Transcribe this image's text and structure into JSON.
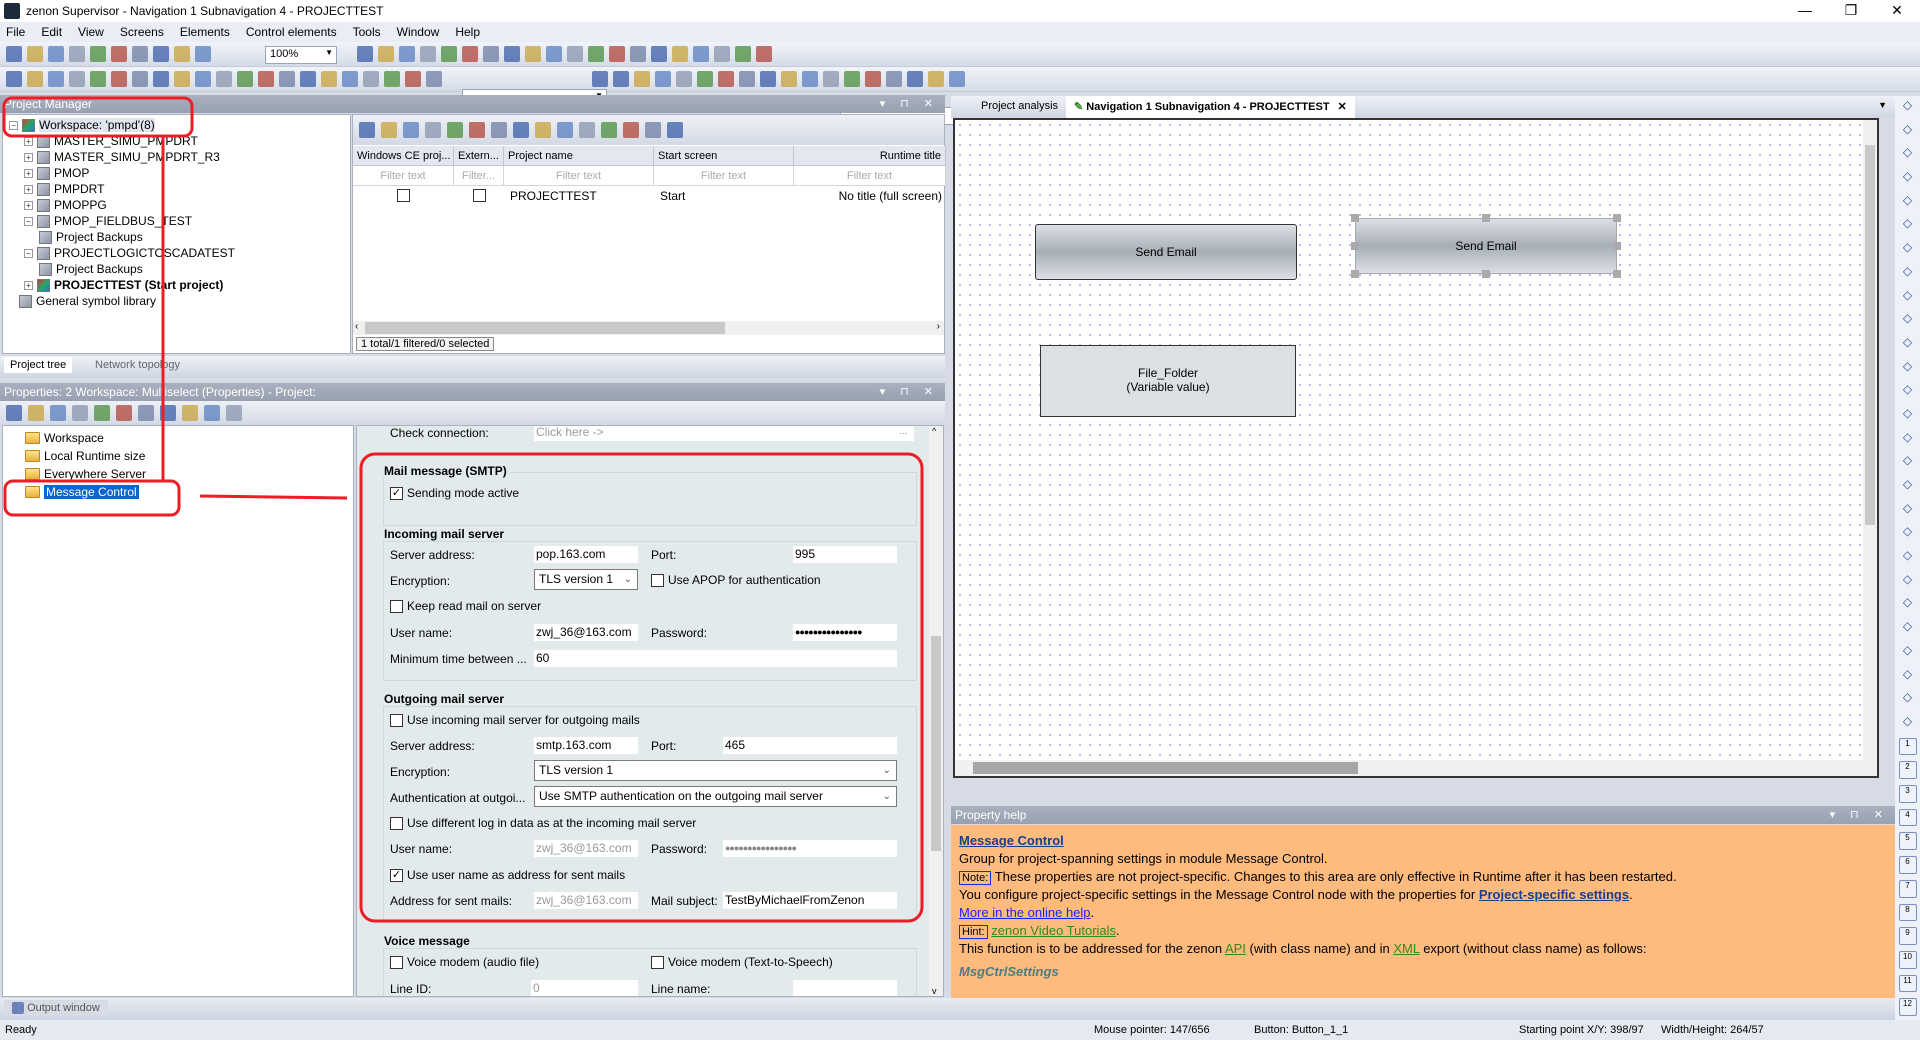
{
  "window": {
    "title": "zenon Supervisor - Navigation 1 Subnavigation 4 - PROJECTTEST",
    "controls": [
      "—",
      "❐",
      "✕"
    ]
  },
  "menu": [
    "File",
    "Edit",
    "View",
    "Screens",
    "Elements",
    "Control elements",
    "Tools",
    "Window",
    "Help"
  ],
  "toolbar": {
    "zoom": "100%",
    "row1_icons": [
      "save-icon",
      "save-all-icon",
      "cut-icon",
      "copy-icon",
      "paste-icon",
      "brush-icon",
      "redo-icon",
      "undo-icon",
      "pointer-icon",
      "zoom-in-icon",
      "zoom-out-icon",
      "help-icon",
      "align-left-icon",
      "align-right-icon",
      "align-top-icon",
      "align-bottom-icon",
      "center-h-icon",
      "center-v-icon",
      "distribute-h-icon",
      "distribute-v-icon",
      "same-width-icon",
      "same-height-icon",
      "to-front-icon",
      "to-back-icon",
      "group-icon",
      "ungroup-icon",
      "rotate-icon",
      "flip-icon",
      "lock-icon",
      "grid-icon",
      "snap-icon"
    ],
    "row2_icons": [
      "new-project-icon",
      "import-icon",
      "export-icon",
      "find-icon",
      "run-icon",
      "compile-icon",
      "check-icon",
      "move-down-icon",
      "move-up-icon",
      "step1-icon",
      "step2-icon",
      "step3-icon",
      "step4-icon",
      "verify-icon",
      "user-icon",
      "user-up-icon",
      "user-down-icon",
      "frame-icon",
      "frame-stop-icon",
      "user-key-icon",
      "user-search-icon",
      "tag-icon",
      "search-icon",
      "layer1-icon",
      "layer2-icon",
      "layer3-icon",
      "layer4-icon",
      "link-icon",
      "chart-icon",
      "filter-icon",
      "sort-icon",
      "print-icon",
      "preview-icon",
      "undo2-icon",
      "redo2-icon",
      "text-icon",
      "list-icon",
      "table-icon",
      "matrix-icon"
    ]
  },
  "project_manager": {
    "title": "Project Manager",
    "tree": [
      {
        "label": "Workspace: 'pmpd'(8)",
        "expander": "−"
      },
      {
        "label": "MASTER_SIMU_PMPDRT",
        "expander": "+"
      },
      {
        "label": "MASTER_SIMU_PMPDRT_R3",
        "expander": "+"
      },
      {
        "label": "PMOP",
        "expander": "+"
      },
      {
        "label": "PMPDRT",
        "expander": "+"
      },
      {
        "label": "PMOPPG",
        "expander": "+"
      },
      {
        "label": "PMOP_FIELDBUS_TEST",
        "expander": "−"
      },
      {
        "label": "Project Backups",
        "expander": ""
      },
      {
        "label": "PROJECTLOGICTOSCADATEST",
        "expander": "−"
      },
      {
        "label": "Project Backups",
        "expander": ""
      },
      {
        "label": "PROJECTTEST (Start project)",
        "expander": "+"
      },
      {
        "label": "General symbol library",
        "expander": ""
      }
    ],
    "list_toolbar_icons": [
      "new-project-icon",
      "add-icon",
      "version-icon",
      "backup-icon",
      "delete-icon",
      "wizard-icon",
      "build-icon",
      "settings-icon",
      "compare-icon",
      "tools-icon",
      "puzzle-icon",
      "refresh-icon",
      "filter-icon",
      "export-icon",
      "help-icon"
    ],
    "columns": [
      "Windows CE proj...",
      "Extern...",
      "Project name",
      "Start screen",
      "Runtime title"
    ],
    "filters": [
      "Filter text",
      "Filter...",
      "Filter text",
      "Filter text",
      "Filter text"
    ],
    "row": {
      "windows_ce": false,
      "external": false,
      "project_name": "PROJECTTEST",
      "start_screen": "Start",
      "runtime_title": "No title (full screen)"
    },
    "status": "1 total/1 filtered/0 selected",
    "tabs": [
      "Project tree",
      "Network topology"
    ]
  },
  "properties": {
    "title": "Properties: 2 Workspace: Multiselect (Properties) - Project:",
    "tree": [
      "Workspace",
      "Local Runtime size",
      "Everywhere Server",
      "Message Control"
    ],
    "check_connection": {
      "label": "Check connection:",
      "value": "Click here ->",
      "button": "..."
    },
    "smtp": {
      "title": "Mail message (SMTP)",
      "sending_mode_label": "Sending mode active",
      "sending_mode": true
    },
    "incoming": {
      "title": "Incoming mail server",
      "server_label": "Server address:",
      "server": "pop.163.com",
      "port_label": "Port:",
      "port": "995",
      "encryption_label": "Encryption:",
      "encryption": "TLS version 1",
      "apop_label": "Use APOP for authentication",
      "apop": false,
      "keep_label": "Keep read mail on server",
      "keep": false,
      "user_label": "User name:",
      "user": "zwj_36@163.com",
      "password_label": "Password:",
      "password": "●●●●●●●●●●●●●●●",
      "min_time_label": "Minimum time between ...",
      "min_time": "60"
    },
    "outgoing": {
      "title": "Outgoing mail server",
      "use_incoming_label": "Use incoming mail server for outgoing mails",
      "use_incoming": false,
      "server_label": "Server address:",
      "server": "smtp.163.com",
      "port_label": "Port:",
      "port": "465",
      "encryption_label": "Encryption:",
      "encryption": "TLS version 1",
      "auth_label": "Authentication at outgoi...",
      "auth": "Use SMTP authentication on the outgoing mail server",
      "diff_login_label": "Use different log in data as at the incoming mail server",
      "diff_login": false,
      "user_label": "User name:",
      "user": "zwj_36@163.com",
      "password_label": "Password:",
      "password": "●●●●●●●●●●●●●●●●",
      "use_user_label": "Use user name as address for sent mails",
      "use_user": true,
      "address_label": "Address for sent mails:",
      "address": "zwj_36@163.com",
      "subject_label": "Mail subject:",
      "subject": "TestByMichaelFromZenon"
    },
    "voice": {
      "title": "Voice message",
      "audio_label": "Voice modem (audio file)",
      "audio": false,
      "tts_label": "Voice modem (Text-to-Speech)",
      "tts": false,
      "line_id_label": "Line ID:",
      "line_id": "0",
      "line_name_label": "Line name:",
      "line_name": ""
    }
  },
  "editor": {
    "tabs": [
      "Project analysis",
      "Navigation 1 Subnavigation 4 - PROJECTTEST"
    ],
    "elements": {
      "send_email_1": "Send Email",
      "send_email_2": "Send Email",
      "file_folder": "File_Folder",
      "file_folder_sub": "(Variable value)"
    }
  },
  "property_help": {
    "title": "Property help",
    "heading": "Message Control",
    "line1": "Group for project-spanning settings in module Message Control.",
    "note_badge": "Note:",
    "note": "These properties are not project-specific. Changes to this area are only effective in Runtime after it has been restarted.",
    "line3a": "You configure project-specific settings in the Message Control node with the properties for ",
    "line3_link": "Project-specific settings",
    "online_help": "More in the online help",
    "hint_badge": "Hint:",
    "video": "zenon Video Tutorials",
    "line6a": "This function is to be addressed for the zenon ",
    "api": "API",
    "line6b": " (with class name) and in ",
    "xml": "XML",
    "line6c": " export (without class name) as follows:",
    "class_name": "MsgCtrlSettings",
    "bg_color": "#ffbb7d"
  },
  "output_window": {
    "label": "Output window"
  },
  "status": {
    "ready": "Ready",
    "mouse": "Mouse pointer: 147/656",
    "button": "Button: Button_1_1",
    "start": "Starting point X/Y: 398/97",
    "size": "Width/Height: 264/57"
  },
  "toolbox": {
    "icons": [
      "pointer-tool-icon",
      "ellipse-tool-icon",
      "arc-tool-icon",
      "polygon-tool-icon",
      "line-tool-icon",
      "polyline-tool-icon",
      "polyline2-tool-icon",
      "rectangle-tool-icon",
      "step-tool-icon",
      "table-tool-icon",
      "button-tool-icon",
      "switch-tool-icon",
      "slider-tool-icon",
      "percent-tool-icon",
      "bar-tool-icon",
      "chart-tool-icon",
      "gauge-tool-icon",
      "valve-tool-icon",
      "clock-tool-icon",
      "combo-tool-icon",
      "text-tool-icon",
      "abc-tool-icon",
      "trend-tool-icon",
      "cross-tool-icon",
      "star-tool-icon",
      "eye-tool-icon",
      "delete-tool-icon"
    ],
    "layers": [
      "1",
      "2",
      "3",
      "4",
      "5",
      "6",
      "7",
      "8",
      "9",
      "10",
      "11",
      "12"
    ]
  }
}
